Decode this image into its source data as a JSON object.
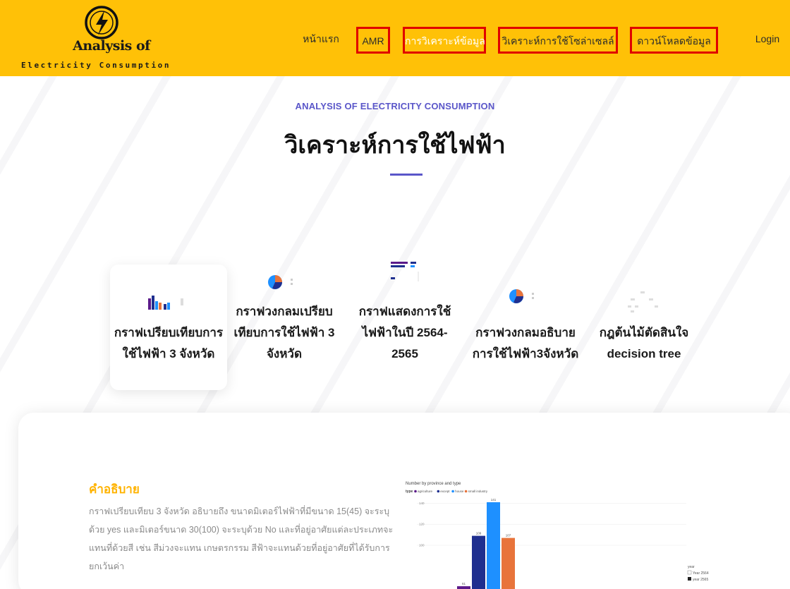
{
  "header": {
    "logo_title": "Analysis of",
    "logo_subtitle": "Electricity Consumption",
    "nav": [
      {
        "label": "หน้าแรก",
        "boxed": false,
        "active": false
      },
      {
        "label": "AMR",
        "boxed": true,
        "active": false
      },
      {
        "label": "การวิเคราะห์ข้อมูล",
        "boxed": true,
        "active": true
      },
      {
        "label": "วิเคราะห์การใช้โซล่าเซลล์",
        "boxed": true,
        "active": false
      },
      {
        "label": "ดาวน์โหลดข้อมูล",
        "boxed": true,
        "active": false
      },
      {
        "label": "Login",
        "boxed": false,
        "active": false
      }
    ],
    "colors": {
      "bar": "#ffc107",
      "highlight_box": "#e00000"
    }
  },
  "section": {
    "kicker": "ANALYSIS OF ELECTRICITY CONSUMPTION",
    "title": "วิเคราะห์การใช้ไฟฟ้า",
    "accent_color": "#5a56c9"
  },
  "cards": [
    {
      "lines": [
        "กราฟเปรียบเทียบการ",
        "ใช้ไฟฟ้า 3 จังหวัด"
      ],
      "thumb": "bar-chart-thumbnail",
      "active": true
    },
    {
      "lines": [
        "กราฟวงกลมเปรียบ",
        "เทียบการใช้ไฟฟ้า 3",
        "จังหวัด"
      ],
      "thumb": "pie-chart-thumbnail",
      "active": false
    },
    {
      "lines": [
        "กราฟแสดงการใช้",
        "ไฟฟ้าในปี 2564-",
        "2565"
      ],
      "thumb": "horizontal-bar-thumbnail",
      "active": false
    },
    {
      "lines": [
        "กราฟวงกลมอธิบาย",
        "การใช้ไฟฟ้า3จังหวัด"
      ],
      "thumb": "pie-chart-thumbnail",
      "active": false
    },
    {
      "lines": [
        "กฎต้นไม้ตัดสินใจ",
        "decision tree"
      ],
      "thumb": "decision-tree-thumbnail",
      "active": false
    }
  ],
  "description": {
    "title": "คำอธิบาย",
    "text": "กราฟเปรียบเทียบ 3 จังหวัด อธิบายถึง ขนาดมิเตอร์ไฟฟ้าที่มีขนาด 15(45) จะระบุด้วย yes และมิเตอร์ขนาด 30(100) จะระบุด้วย No และที่อยู่อาศัยแต่ละประเภทจะแทนที่ด้วยสี เช่น สีม่วงจะแทน เกษตรกรรม สีฟ้าจะแทนด้วยที่อยู่อาศัยที่ได้รับการยกเว้นค่า",
    "title_color": "#ffb300"
  },
  "chart_data": {
    "type": "bar",
    "title": "Number by province and type",
    "legend_title": "type",
    "legend_placement": "top",
    "series": [
      {
        "name": "agriculture",
        "color": "#5b1a8a",
        "values": [
          61
        ]
      },
      {
        "name": "except",
        "color": "#1f2f8f",
        "values": [
          109
        ]
      },
      {
        "name": "house",
        "color": "#1e90ff",
        "values": [
          141
        ]
      },
      {
        "name": "small industry",
        "color": "#e8743b",
        "values": [
          107
        ]
      }
    ],
    "y_ticks": [
      "140",
      "120",
      "100"
    ],
    "ylim": [
      55,
      145
    ],
    "grid": true,
    "year_legend": {
      "title": "year",
      "items": [
        "Year 2564",
        "year 2565"
      ]
    }
  }
}
